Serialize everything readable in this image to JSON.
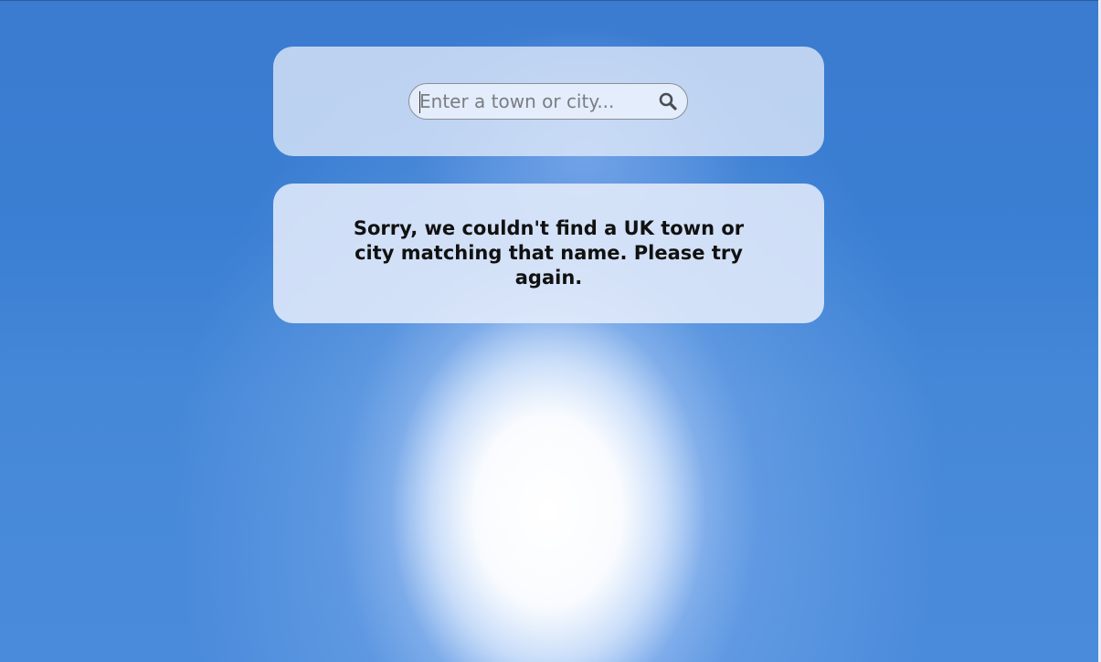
{
  "search": {
    "placeholder": "Enter a town or city...",
    "value": "",
    "button_icon": "search-icon"
  },
  "result": {
    "message": "Sorry, we couldn't find a UK town or city matching that name. Please try again."
  },
  "colors": {
    "sky": "#3b7bd0",
    "panel": "#e1ebfa",
    "text": "#111111",
    "border": "#8a8f96"
  }
}
